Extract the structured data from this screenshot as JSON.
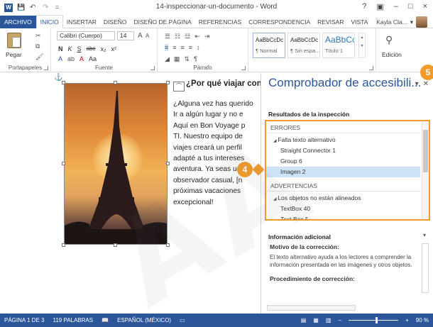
{
  "window": {
    "title": "14-inspeccionar-un-documento - Word",
    "controls": [
      "?",
      "▣",
      "–",
      "□",
      "×"
    ]
  },
  "qat": {
    "app_icon": "W",
    "save": "💾",
    "undo": "↶",
    "redo": "↷",
    "customize": "="
  },
  "tabs": [
    "ARCHIVO",
    "INICIO",
    "INSERTAR",
    "DISEÑO",
    "DISEÑO DE PÁGINA",
    "REFERENCIAS",
    "CORRESPONDENCIA",
    "REVISAR",
    "VISTA"
  ],
  "active_tab": "INICIO",
  "user": {
    "name": "Kayla Cla...",
    "chevron": "▾"
  },
  "ribbon": {
    "clipboard": {
      "paste": "Pegar",
      "label": "Portapapeles"
    },
    "font": {
      "family": "Calibri (Cuerpo)",
      "size": "14",
      "grow": "A",
      "shrink": "A",
      "bold": "N",
      "italic": "K",
      "underline": "S",
      "strike": "abc",
      "sub": "x₂",
      "sup": "x²",
      "case": "Aa",
      "label": "Fuente"
    },
    "paragraph": {
      "label": "Párrafo"
    },
    "styles": [
      {
        "preview": "AaBbCcDc",
        "name": "¶ Normal"
      },
      {
        "preview": "AaBbCcDc",
        "name": "¶ Sin espa..."
      },
      {
        "preview": "AaBbCc",
        "name": "Título 1"
      }
    ],
    "styles_label": "Estilos",
    "editing": {
      "label": "Edición"
    }
  },
  "document": {
    "heading": "¿Por qué viajar con",
    "paragraph": [
      "¿Alguna vez has querido",
      "Ir a algún lugar y no e",
      "Aquí en Bon Voyage p",
      "TI. Nuestro equipo de",
      "viajes creará un perfil",
      "adapté a tus intereses",
      "aventura. Ya seas un",
      "observador casual, [n",
      "próximas vacaciones",
      "excepcional!"
    ]
  },
  "callouts": {
    "list": "4",
    "close": "5"
  },
  "pane": {
    "title": "Comprobador de accesibili...",
    "results_label": "Resultados de la inspección",
    "errors_header": "ERRORES",
    "errors_category": "Falta texto alternativo",
    "errors_items": [
      "Straight Connector 1",
      "Group 6",
      "Imagen 2"
    ],
    "selected_item": "Imagen 2",
    "warnings_header": "ADVERTENCIAS",
    "warnings_category": "Los objetos no están alineados",
    "warnings_items": [
      "TextBox 40",
      "Text Box 5"
    ],
    "info_header": "Información adicional",
    "info_sub": "Motivo de la corrección:",
    "info_text": "El texto alternativo ayuda a los lectores a comprender la información presentada en las imágenes y otros objetos.",
    "info_sub2": "Procedimiento de corrección:"
  },
  "watermark": "AA",
  "statusbar": {
    "page": "PÁGINA 1 DE 3",
    "words": "119 PALABRAS",
    "language": "ESPAÑOL (MÉXICO)",
    "zoom": "90 %"
  }
}
